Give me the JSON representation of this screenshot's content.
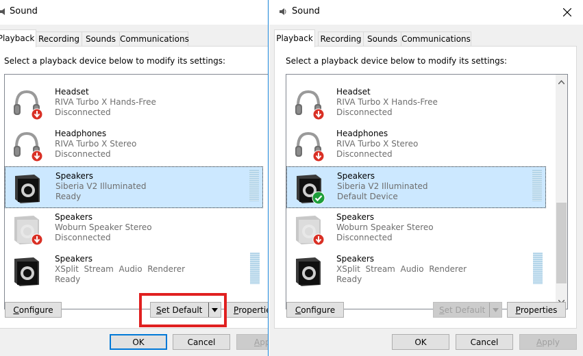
{
  "title": "Sound",
  "tabs": [
    "Playback",
    "Recording",
    "Sounds",
    "Communications"
  ],
  "instruction": "Select a playback device below to modify its settings:",
  "devices_left": [
    {
      "name": "Headset",
      "model": "RIVA Turbo X Hands-Free",
      "status": "Disconnected",
      "kind": "headset-icon",
      "badge": "disconnected"
    },
    {
      "name": "Headphones",
      "model": "RIVA Turbo X Stereo",
      "status": "Disconnected",
      "kind": "headset-icon",
      "badge": "disconnected"
    },
    {
      "name": "Speakers",
      "model": "Siberia V2 Illuminated",
      "status": "Ready",
      "kind": "speaker-icon",
      "badge": "none",
      "selected": true,
      "meter": true
    },
    {
      "name": "Speakers",
      "model": "Woburn Speaker Stereo",
      "status": "Disconnected",
      "kind": "speaker-icon",
      "badge": "disconnected",
      "faded": true
    },
    {
      "name": "Speakers",
      "model": "XSplit  Stream  Audio  Renderer",
      "status": "Ready",
      "kind": "speaker-icon",
      "badge": "none",
      "meter": true
    }
  ],
  "devices_right": [
    {
      "name": "Headset",
      "model": "RIVA Turbo X Hands-Free",
      "status": "Disconnected",
      "kind": "headset-icon",
      "badge": "disconnected"
    },
    {
      "name": "Headphones",
      "model": "RIVA Turbo X Stereo",
      "status": "Disconnected",
      "kind": "headset-icon",
      "badge": "disconnected"
    },
    {
      "name": "Speakers",
      "model": "Siberia V2 Illuminated",
      "status": "Default Device",
      "kind": "speaker-icon",
      "badge": "default",
      "selected": true,
      "meter": true
    },
    {
      "name": "Speakers",
      "model": "Woburn Speaker Stereo",
      "status": "Disconnected",
      "kind": "speaker-icon",
      "badge": "disconnected",
      "faded": true
    },
    {
      "name": "Speakers",
      "model": "XSplit  Stream  Audio  Renderer",
      "status": "Ready",
      "kind": "speaker-icon",
      "badge": "none",
      "meter": true
    }
  ],
  "buttons": {
    "configure_prefix": "C",
    "configure_rest": "onfigure",
    "set_default_prefix": "S",
    "set_default_rest": "et Default",
    "properties_prefix": "P",
    "properties_rest": "roperties",
    "properties_left_rest": "ropertie",
    "ok": "OK",
    "cancel": "Cancel",
    "apply_prefix": "A",
    "apply_rest": "pply",
    "apply_left_rest": "pp"
  },
  "colors": {
    "accent": "#0078d7",
    "selection": "#cce8ff",
    "highlight": "#e02020",
    "disconnected_badge": "#d93025",
    "default_badge": "#1e9e3a"
  }
}
